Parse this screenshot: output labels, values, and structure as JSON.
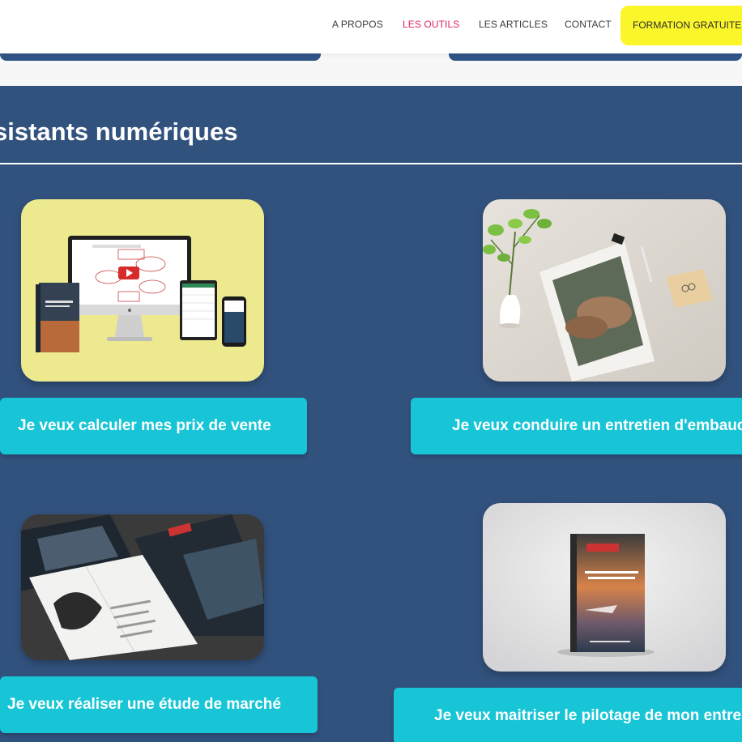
{
  "nav": {
    "items": [
      {
        "label": "A PROPOS",
        "active": false
      },
      {
        "label": "LES OUTILS",
        "active": true
      },
      {
        "label": "LES ARTICLES",
        "active": false
      },
      {
        "label": "CONTACT",
        "active": false
      }
    ],
    "cta_label": "FORMATION GRATUITE"
  },
  "section": {
    "title": "sistants numériques"
  },
  "cards": [
    {
      "button_label": "Je veux calculer mes prix de vente",
      "image": "pricing-tool-mockup"
    },
    {
      "button_label": "Je veux conduire un entretien d'embauche",
      "image": "job-interview-document-photo"
    },
    {
      "button_label": "Je veux réaliser une étude de marché",
      "image": "market-study-booklet-photo"
    },
    {
      "button_label": "Je veux maitriser le pilotage de mon entreprise",
      "image": "business-steering-book-photo"
    }
  ],
  "colors": {
    "section_bg": "#32527e",
    "button_bg": "#17c5d7",
    "cta_bg": "#fbf62a",
    "nav_active": "#e0245e"
  }
}
